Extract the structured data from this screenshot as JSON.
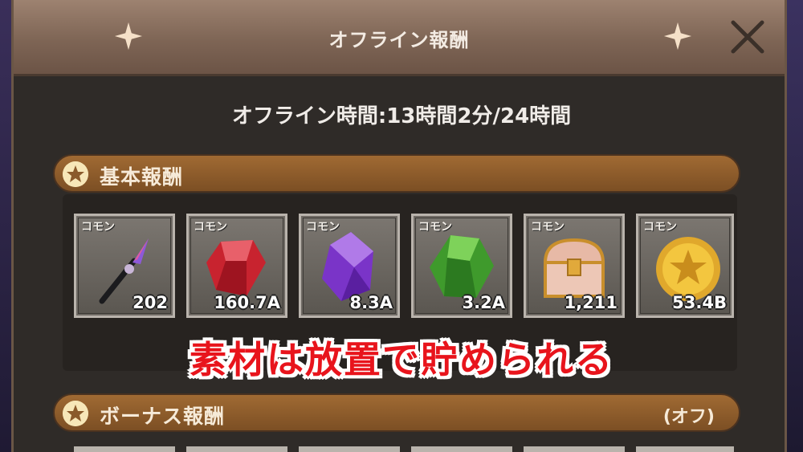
{
  "dialog": {
    "title": "オフライン報酬",
    "offline_time": "オフライン時間:13時間2分/24時間"
  },
  "basic_rewards": {
    "label": "基本報酬",
    "items": [
      {
        "rarity": "コモン",
        "count": "202",
        "icon": "staff-icon"
      },
      {
        "rarity": "コモン",
        "count": "160.7A",
        "icon": "red-gem-icon"
      },
      {
        "rarity": "コモン",
        "count": "8.3A",
        "icon": "purple-crystal-icon"
      },
      {
        "rarity": "コモン",
        "count": "3.2A",
        "icon": "green-gem-icon"
      },
      {
        "rarity": "コモン",
        "count": "1,211",
        "icon": "treasure-chest-icon"
      },
      {
        "rarity": "コモン",
        "count": "53.4B",
        "icon": "gold-coin-icon"
      }
    ]
  },
  "bonus_rewards": {
    "label": "ボーナス報酬",
    "status": "(オフ)"
  },
  "caption": "素材は放置で貯められる",
  "colors": {
    "caption": "#e8141c",
    "section_header": "#8a5a2b",
    "titlebar": "#8c7261"
  }
}
